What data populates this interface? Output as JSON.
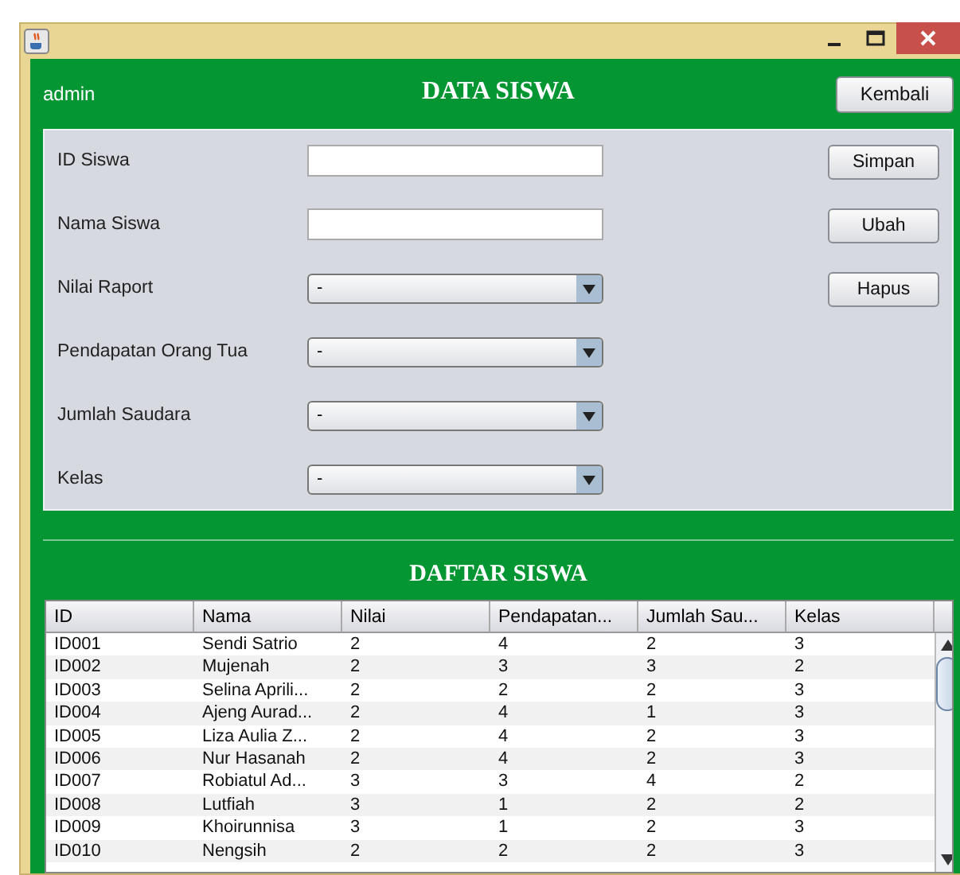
{
  "header": {
    "user": "admin",
    "title": "DATA SISWA",
    "back_button": "Kembali"
  },
  "form": {
    "fields": [
      {
        "label": "ID Siswa",
        "kind": "text"
      },
      {
        "label": "Nama Siswa",
        "kind": "text"
      },
      {
        "label": "Nilai Raport",
        "kind": "combo",
        "value": "-"
      },
      {
        "label": "Pendapatan Orang Tua",
        "kind": "combo",
        "value": "-"
      },
      {
        "label": "Jumlah Saudara",
        "kind": "combo",
        "value": "-"
      },
      {
        "label": "Kelas",
        "kind": "combo",
        "value": "-"
      }
    ],
    "buttons": [
      "Simpan",
      "Ubah",
      "Hapus"
    ]
  },
  "table": {
    "title": "DAFTAR SISWA",
    "columns": [
      "ID",
      "Nama",
      "Nilai",
      "Pendapatan...",
      "Jumlah Sau...",
      "Kelas"
    ],
    "rows": [
      [
        "ID001",
        "Sendi Satrio",
        "2",
        "4",
        "2",
        "3"
      ],
      [
        "ID002",
        "Mujenah",
        "2",
        "3",
        "3",
        "2"
      ],
      [
        "ID003",
        "Selina Aprili...",
        "2",
        "2",
        "2",
        "3"
      ],
      [
        "ID004",
        "Ajeng Aurad...",
        "2",
        "4",
        "1",
        "3"
      ],
      [
        "ID005",
        "Liza Aulia Z...",
        "2",
        "4",
        "2",
        "3"
      ],
      [
        "ID006",
        "Nur Hasanah",
        "2",
        "4",
        "2",
        "3"
      ],
      [
        "ID007",
        "Robiatul Ad...",
        "3",
        "3",
        "4",
        "2"
      ],
      [
        "ID008",
        "Lutfiah",
        "3",
        "1",
        "2",
        "2"
      ],
      [
        "ID009",
        "Khoirunnisa",
        "3",
        "1",
        "2",
        "3"
      ],
      [
        "ID010",
        "Nengsih",
        "2",
        "2",
        "2",
        "3"
      ]
    ]
  }
}
